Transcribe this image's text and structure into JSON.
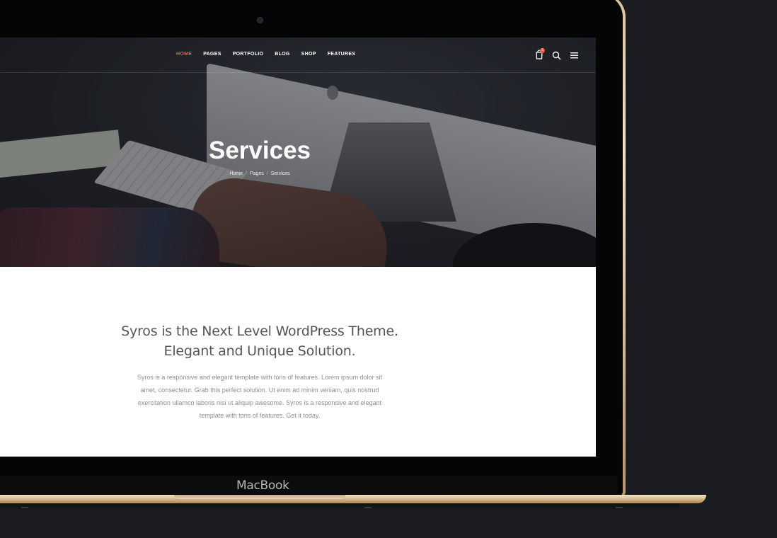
{
  "device": {
    "brand_label": "MacBook"
  },
  "nav": {
    "items": [
      {
        "label": "HOME",
        "active": true
      },
      {
        "label": "PAGES",
        "active": false
      },
      {
        "label": "PORTFOLIO",
        "active": false
      },
      {
        "label": "BLOG",
        "active": false
      },
      {
        "label": "SHOP",
        "active": false
      },
      {
        "label": "FEATURES",
        "active": false
      }
    ],
    "cart_count": "0",
    "icons": [
      "cart-icon",
      "search-icon",
      "menu-icon"
    ],
    "accent_color": "#e6593f"
  },
  "hero": {
    "title": "Services",
    "breadcrumb": [
      "Home",
      "Pages",
      "Services"
    ],
    "separator": "/"
  },
  "content": {
    "headline_line1": "Syros is the Next Level WordPress Theme.",
    "headline_line2": "Elegant and Unique Solution.",
    "body": "Syros is a responsive and elegant template with tons of features. Lorem ipsum dolor sit amet, consectetur. Grab this perfect solution. Ut enim ad minim veniam, quis nostrud exercitation ullamco laboris nisi ut aliquip awesome. Syros is a responsive and elegant template with tons of features. Get it today."
  }
}
